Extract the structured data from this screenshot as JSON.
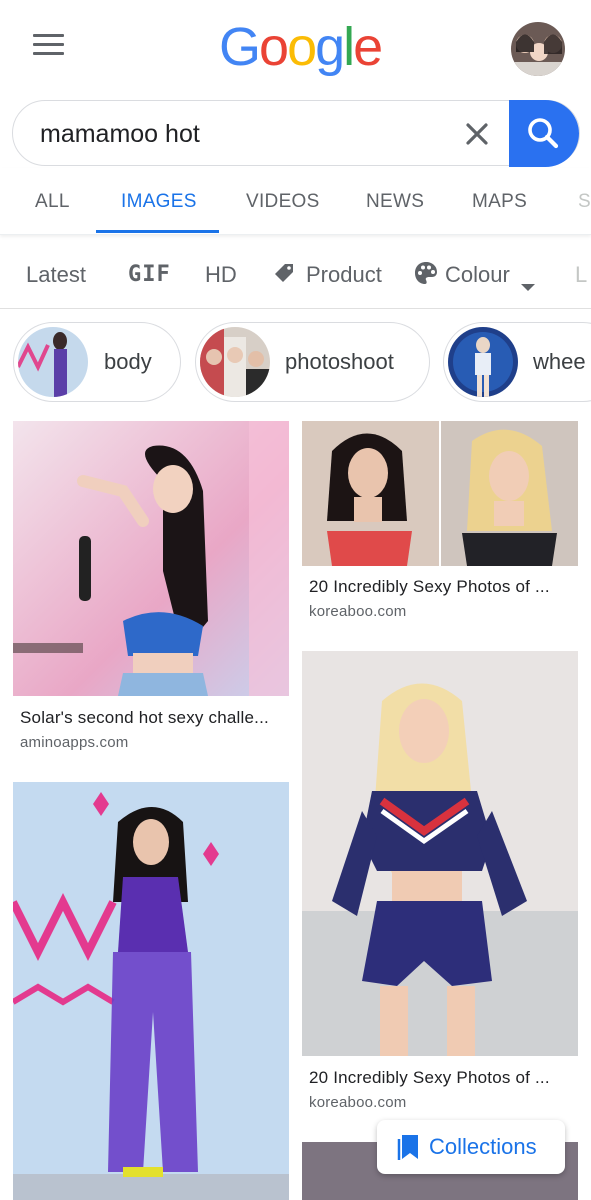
{
  "header": {
    "logo": [
      "G",
      "o",
      "o",
      "g",
      "l",
      "e"
    ],
    "logo_colors": [
      "#4285f4",
      "#ea4335",
      "#fbbc05",
      "#4285f4",
      "#34a853",
      "#ea4335"
    ]
  },
  "search": {
    "query": "mamamoo hot"
  },
  "tabs": [
    {
      "label": "ALL",
      "active": false
    },
    {
      "label": "IMAGES",
      "active": true
    },
    {
      "label": "VIDEOS",
      "active": false
    },
    {
      "label": "NEWS",
      "active": false
    },
    {
      "label": "MAPS",
      "active": false
    },
    {
      "label": "S",
      "active": false
    }
  ],
  "filters": [
    {
      "label": "Latest"
    },
    {
      "label": "GIF"
    },
    {
      "label": "HD"
    },
    {
      "label": "Product",
      "icon": "tag-icon"
    },
    {
      "label": "Colour",
      "icon": "palette-icon"
    },
    {
      "label": "L"
    }
  ],
  "chips": [
    {
      "label": "body"
    },
    {
      "label": "photoshoot"
    },
    {
      "label": "whee"
    }
  ],
  "results": [
    {
      "title": "Solar's second hot sexy challe...",
      "source": "aminoapps.com"
    },
    {
      "title": "20 Incredibly Sexy Photos of ...",
      "source": "koreaboo.com"
    },
    {
      "title": "20 Incredibly Sexy Photos of ...",
      "source": "koreaboo.com"
    }
  ],
  "collections": {
    "label": "Collections"
  },
  "colors": {
    "accent": "#1a73e8",
    "search_button": "#2a71f0"
  }
}
